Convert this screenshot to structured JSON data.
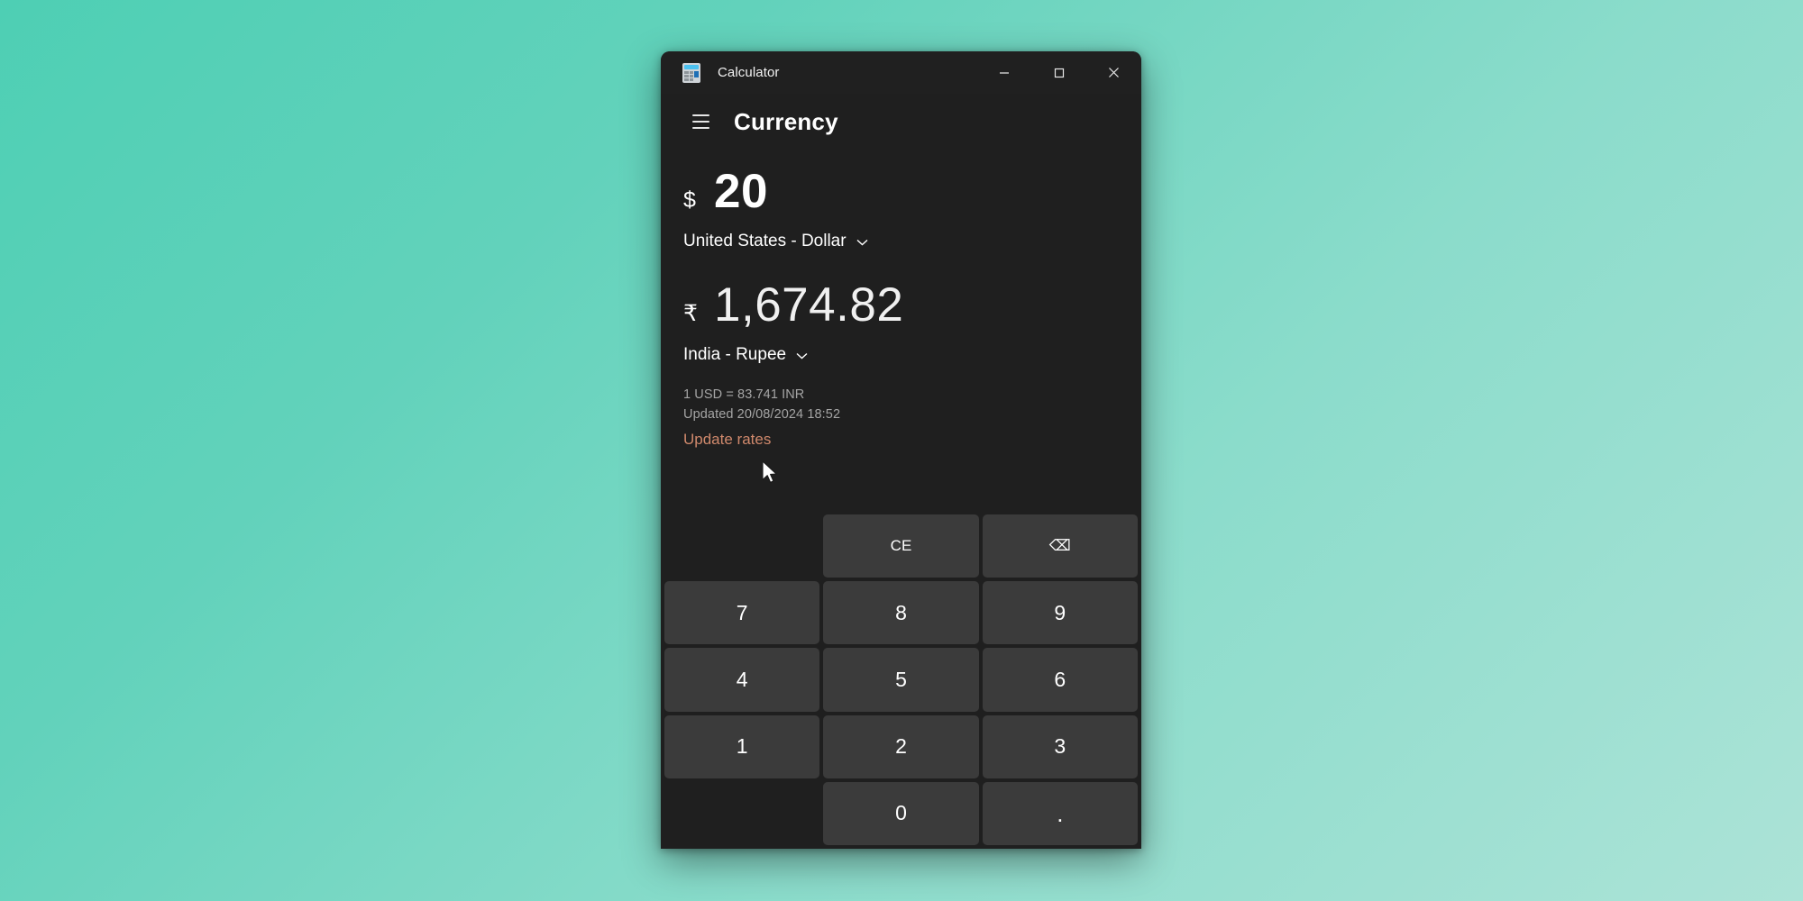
{
  "window": {
    "app_icon": "calculator-icon",
    "title": "Calculator",
    "controls": {
      "minimize": "minimize-icon",
      "maximize": "maximize-icon",
      "close": "close-icon"
    }
  },
  "header": {
    "menu_icon": "hamburger-menu-icon",
    "page_title": "Currency"
  },
  "conversion": {
    "from": {
      "symbol": "$",
      "amount": "20",
      "currency_label": "United States - Dollar",
      "chevron": "chevron-down-icon"
    },
    "to": {
      "symbol": "₹",
      "amount": "1,674.82",
      "currency_label": "India - Rupee",
      "chevron": "chevron-down-icon"
    }
  },
  "rate_info": {
    "rate_line": "1 USD = 83.741 INR",
    "updated_line": "Updated 20/08/2024 18:52",
    "update_link": "Update rates"
  },
  "keypad": {
    "rows": [
      [
        {
          "label": "",
          "name": "key-blank-top-left",
          "type": "blank"
        },
        {
          "label": "CE",
          "name": "key-clear-entry",
          "type": "fn"
        },
        {
          "label": "⌫",
          "name": "backspace-icon",
          "type": "fn"
        }
      ],
      [
        {
          "label": "7",
          "name": "key-7",
          "type": "digit"
        },
        {
          "label": "8",
          "name": "key-8",
          "type": "digit"
        },
        {
          "label": "9",
          "name": "key-9",
          "type": "digit"
        }
      ],
      [
        {
          "label": "4",
          "name": "key-4",
          "type": "digit"
        },
        {
          "label": "5",
          "name": "key-5",
          "type": "digit"
        },
        {
          "label": "6",
          "name": "key-6",
          "type": "digit"
        }
      ],
      [
        {
          "label": "1",
          "name": "key-1",
          "type": "digit"
        },
        {
          "label": "2",
          "name": "key-2",
          "type": "digit"
        },
        {
          "label": "3",
          "name": "key-3",
          "type": "digit"
        }
      ],
      [
        {
          "label": "",
          "name": "key-blank-bottom-left",
          "type": "blank"
        },
        {
          "label": "0",
          "name": "key-0",
          "type": "digit"
        },
        {
          "label": ".",
          "name": "key-decimal-point",
          "type": "dot"
        }
      ]
    ]
  },
  "colors": {
    "desktop_gradient_start": "#4ecfb4",
    "desktop_gradient_end": "#ace3d7",
    "window_background": "#1f1f1f",
    "key_background": "#3b3b3b",
    "link_accent": "#d0896c"
  }
}
